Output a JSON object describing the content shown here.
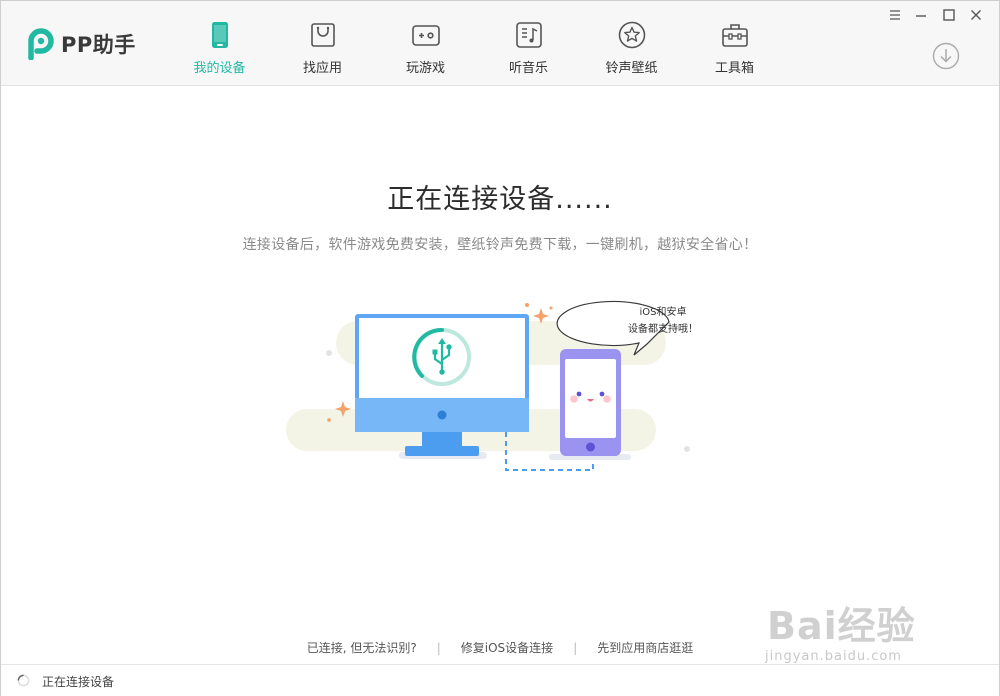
{
  "app": {
    "name": "PP助手",
    "brand_color": "#22b9a3"
  },
  "window_controls": [
    {
      "name": "menu-icon"
    },
    {
      "name": "minimize-icon"
    },
    {
      "name": "maximize-icon"
    },
    {
      "name": "close-icon"
    }
  ],
  "nav": {
    "items": [
      {
        "label": "我的设备",
        "icon": "device-icon",
        "active": true
      },
      {
        "label": "找应用",
        "icon": "shopping-bag-icon",
        "active": false
      },
      {
        "label": "玩游戏",
        "icon": "gamepad-icon",
        "active": false
      },
      {
        "label": "听音乐",
        "icon": "music-icon",
        "active": false
      },
      {
        "label": "铃声壁纸",
        "icon": "star-circle-icon",
        "active": false
      },
      {
        "label": "工具箱",
        "icon": "toolbox-icon",
        "active": false
      }
    ],
    "download_icon": "download-icon"
  },
  "main": {
    "title": "正在连接设备......",
    "subtitle": "连接设备后，软件游戏免费安装，壁纸铃声免费下载，一键刷机，越狱安全省心！",
    "bubble_line1": "iOS和安卓",
    "bubble_line2": "设备都支持哦！"
  },
  "links": {
    "connected_unrecognized": "已连接, 但无法识别?",
    "repair_ios": "修复iOS设备连接",
    "go_store": "先到应用商店逛逛"
  },
  "status": {
    "text": "正在连接设备"
  },
  "watermark": {
    "brand": "Bai经验",
    "url": "jingyan.baidu.com"
  }
}
